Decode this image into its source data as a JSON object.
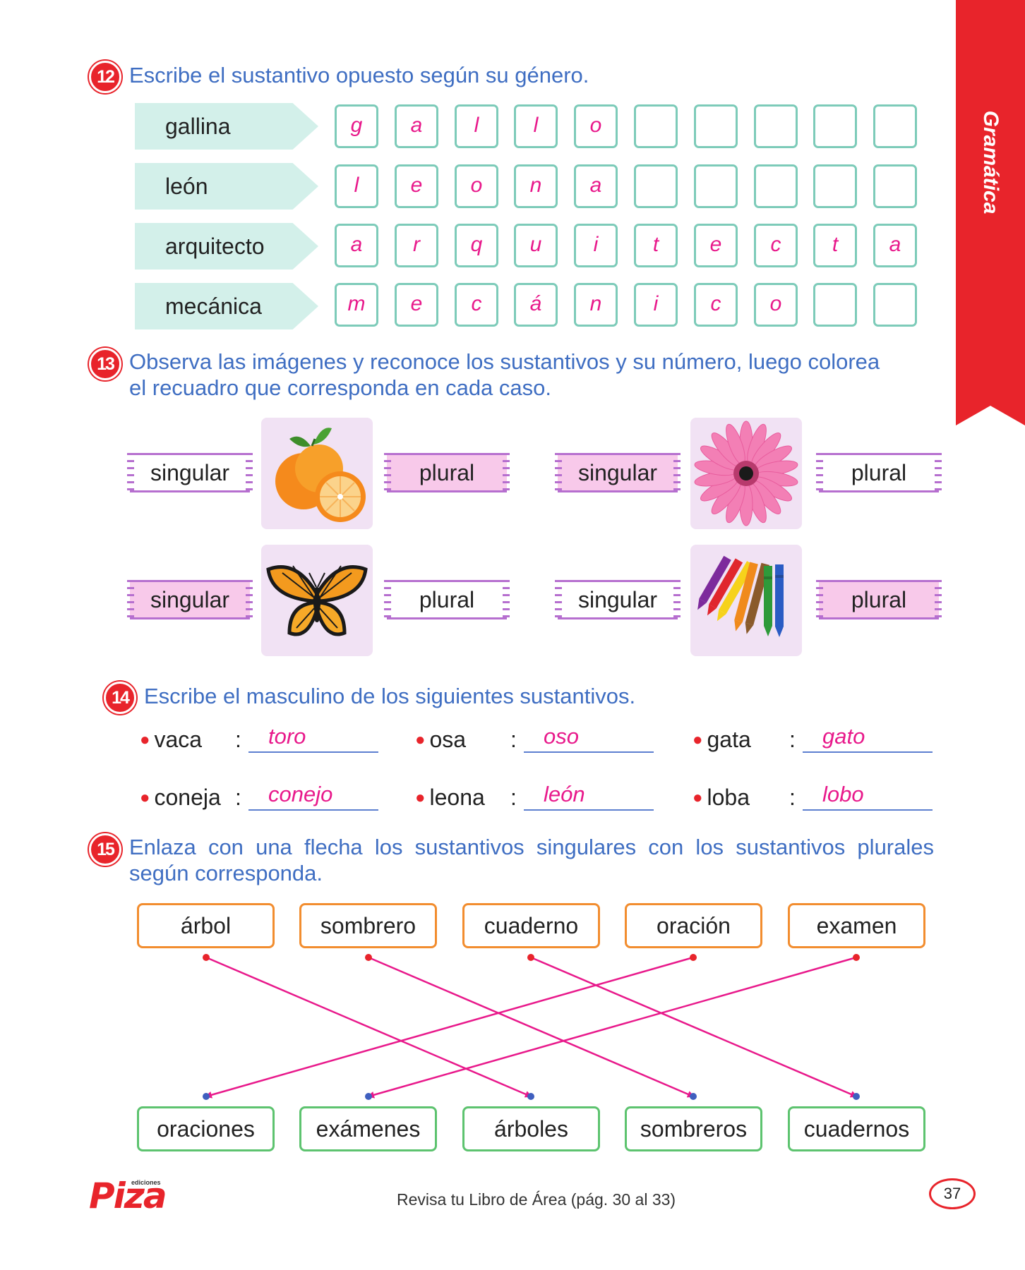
{
  "side_tab": {
    "text": "Gramática"
  },
  "ex12": {
    "number": "12",
    "instruction": "Escribe el sustantivo opuesto según su género.",
    "rows": [
      {
        "word": "gallina",
        "letters": [
          "g",
          "a",
          "l",
          "l",
          "o",
          "",
          "",
          "",
          "",
          ""
        ]
      },
      {
        "word": "león",
        "letters": [
          "l",
          "e",
          "o",
          "n",
          "a",
          "",
          "",
          "",
          "",
          ""
        ]
      },
      {
        "word": "arquitecto",
        "letters": [
          "a",
          "r",
          "q",
          "u",
          "i",
          "t",
          "e",
          "c",
          "t",
          "a"
        ]
      },
      {
        "word": "mecánica",
        "letters": [
          "m",
          "e",
          "c",
          "á",
          "n",
          "i",
          "c",
          "o",
          "",
          ""
        ]
      }
    ]
  },
  "ex13": {
    "number": "13",
    "instruction_line1": "Observa las imágenes y reconoce los sustantivos y su número, luego colorea",
    "instruction_line2": "el recuadro que corresponda en cada caso.",
    "items": [
      {
        "image": "oranges",
        "left_label": "singular",
        "right_label": "plural",
        "selected": "plural"
      },
      {
        "image": "pink-flower",
        "left_label": "singular",
        "right_label": "plural",
        "selected": "singular"
      },
      {
        "image": "butterfly",
        "left_label": "singular",
        "right_label": "plural",
        "selected": "singular"
      },
      {
        "image": "crayons",
        "left_label": "singular",
        "right_label": "plural",
        "selected": "plural"
      }
    ]
  },
  "ex14": {
    "number": "14",
    "instruction": "Escribe el masculino de los siguientes sustantivos.",
    "pairs": [
      {
        "word": "vaca",
        "answer": "toro"
      },
      {
        "word": "osa",
        "answer": "oso"
      },
      {
        "word": "gata",
        "answer": "gato"
      },
      {
        "word": "coneja",
        "answer": "conejo"
      },
      {
        "word": "leona",
        "answer": "león"
      },
      {
        "word": "loba",
        "answer": "lobo"
      }
    ],
    "colon": ":"
  },
  "ex15": {
    "number": "15",
    "instruction_line1": "Enlaza con una flecha los sustantivos singulares con los sustantivos plurales",
    "instruction_line2": "según corresponda.",
    "singulars": [
      "árbol",
      "sombrero",
      "cuaderno",
      "oración",
      "examen"
    ],
    "plurals": [
      "oraciones",
      "exámenes",
      "árboles",
      "sombreros",
      "cuadernos"
    ],
    "links": [
      [
        0,
        2
      ],
      [
        1,
        3
      ],
      [
        2,
        4
      ],
      [
        3,
        0
      ],
      [
        4,
        1
      ]
    ],
    "arrow_color": "#e8198b",
    "start_dot_color": "#e8242b",
    "end_dot_color": "#3f5fbf"
  },
  "footer": {
    "logo": "Piza",
    "logo_small": "ediciones",
    "text": "Revisa tu Libro de Área (pág. 30 al 33)",
    "page_number": "37"
  }
}
